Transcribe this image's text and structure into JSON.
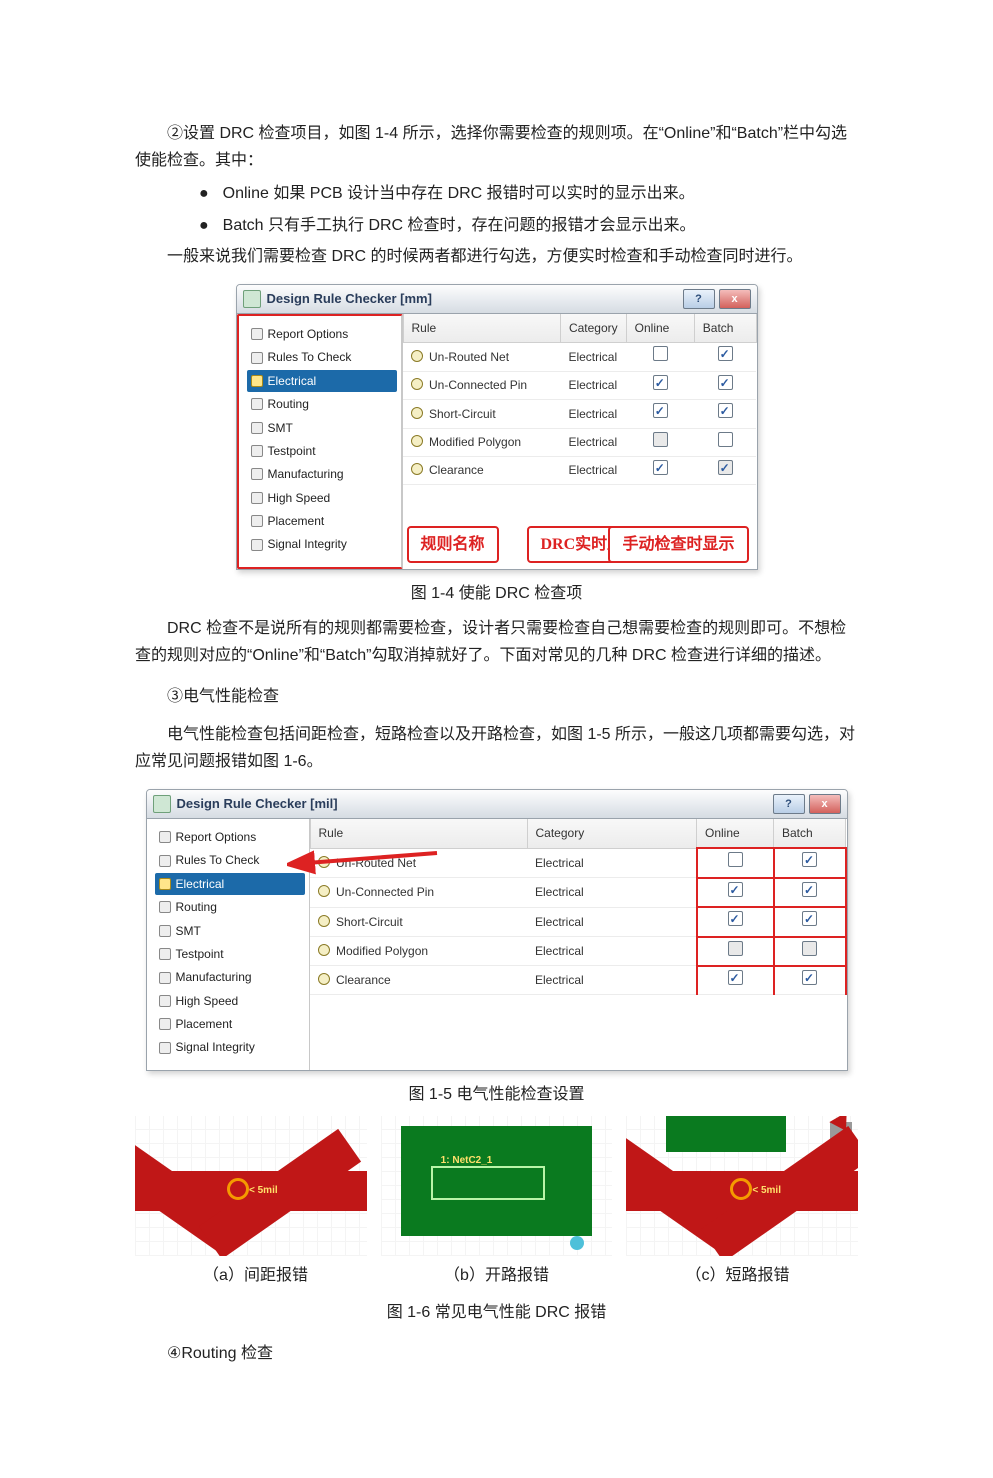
{
  "text": {
    "p1": "②设置 DRC 检查项目，如图 1-4 所示，选择你需要检查的规则项。在“Online”和“Batch”栏中勾选使能检查。其中：",
    "li_online": "Online  如果 PCB 设计当中存在 DRC 报错时可以实时的显示出来。",
    "li_batch": "Batch 只有手工执行 DRC 检查时，存在问题的报错才会显示出来。",
    "p2": "一般来说我们需要检查 DRC 的时候两者都进行勾选，方便实时检查和手动检查同时进行。",
    "fig1_4": "图 1-4  使能 DRC 检查项",
    "p3": "DRC 检查不是说所有的规则都需要检查，设计者只需要检查自己想需要检查的规则即可。不想检查的规则对应的“Online”和“Batch”勾取消掉就好了。下面对常见的几种 DRC 检查进行详细的描述。",
    "h_elec": "③电气性能检查",
    "p4": "电气性能检查包括间距检查，短路检查以及开路检查，如图 1-5 所示，一般这几项都需要勾选，对应常见问题报错如图 1-6。",
    "fig1_5": "图 1-5    电气性能检查设置",
    "lab_a": "（a）间距报错",
    "lab_b": "（b）开路报错",
    "lab_c": "（c）短路报错",
    "fig1_6": "图 1-6  常见电气性能 DRC 报错",
    "h_routing": "④Routing 检查",
    "bullet": "●"
  },
  "dlg1": {
    "title": "Design Rule Checker [mm]",
    "tree": [
      "Report Options",
      "Rules To Check",
      "Electrical",
      "Routing",
      "SMT",
      "Testpoint",
      "Manufacturing",
      "High Speed",
      "Placement",
      "Signal Integrity"
    ],
    "head": {
      "rule": "Rule",
      "category": "Category",
      "online": "Online",
      "batch": "Batch"
    },
    "rows": [
      {
        "rule": "Un-Routed Net",
        "cat": "Electrical",
        "online": false,
        "batch": true
      },
      {
        "rule": "Un-Connected Pin",
        "cat": "Electrical",
        "online": true,
        "batch": true
      },
      {
        "rule": "Short-Circuit",
        "cat": "Electrical",
        "online": true,
        "batch": true
      },
      {
        "rule": "Modified Polygon",
        "cat": "Electrical",
        "online": false,
        "batch": false,
        "onlineGray": true
      },
      {
        "rule": "Clearance",
        "cat": "Electrical",
        "online": true,
        "batch": true,
        "batchGray": true
      }
    ],
    "annot": {
      "a": "规则名称",
      "b": "DRC实时显示",
      "c": "手动检查时显示"
    }
  },
  "dlg2": {
    "title": "Design Rule Checker [mil]",
    "tree": [
      "Report Options",
      "Rules To Check",
      "Electrical",
      "Routing",
      "SMT",
      "Testpoint",
      "Manufacturing",
      "High Speed",
      "Placement",
      "Signal Integrity"
    ],
    "head": {
      "rule": "Rule",
      "category": "Category",
      "online": "Online",
      "batch": "Batch"
    },
    "rows": [
      {
        "rule": "Un-Routed Net",
        "cat": "Electrical",
        "online": false,
        "batch": true
      },
      {
        "rule": "Un-Connected Pin",
        "cat": "Electrical",
        "online": true,
        "batch": true
      },
      {
        "rule": "Short-Circuit",
        "cat": "Electrical",
        "online": true,
        "batch": true
      },
      {
        "rule": "Modified Polygon",
        "cat": "Electrical",
        "online": false,
        "batch": false,
        "onlineGray": true,
        "batchGray": true
      },
      {
        "rule": "Clearance",
        "cat": "Electrical",
        "online": true,
        "batch": true
      }
    ]
  },
  "thumbLabels": {
    "a": "< 5mil",
    "b": "1: NetC2_1",
    "c": "< 5mil"
  }
}
